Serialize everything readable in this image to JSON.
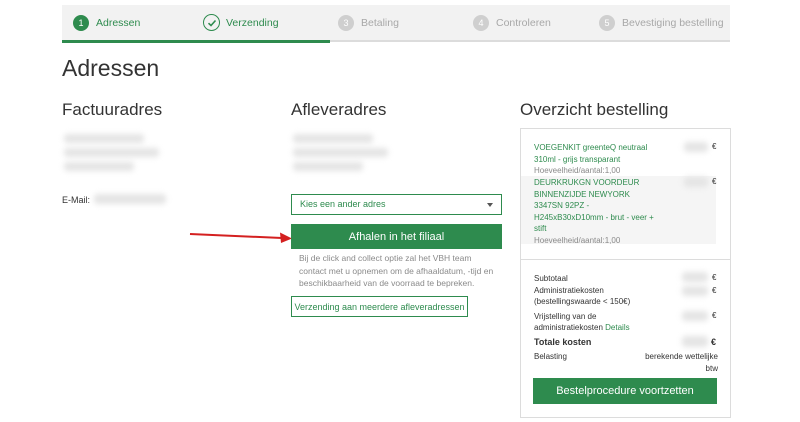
{
  "stepper": {
    "steps": [
      {
        "num": "1",
        "label": "Adressen"
      },
      {
        "label": "Verzending"
      },
      {
        "num": "3",
        "label": "Betaling"
      },
      {
        "num": "4",
        "label": "Controleren"
      },
      {
        "num": "5",
        "label": "Bevestiging bestelling"
      }
    ]
  },
  "page": {
    "title": "Adressen"
  },
  "billing": {
    "heading": "Factuuradres",
    "email_label": "E-Mail:"
  },
  "delivery": {
    "heading": "Afleveradres",
    "select_value": "Kies een ander adres",
    "pickup_button": "Afhalen in het filiaal",
    "note": "Bij de click and collect optie zal het VBH team contact met u opnemen om de afhaaldatum, -tijd en beschikbaarheid van de voorraad te bepreken.",
    "multi_button": "Verzending aan meerdere afleveradressen"
  },
  "overview": {
    "heading": "Overzicht bestelling",
    "items": [
      {
        "name": "VOEGENKIT greenteQ neutraal 310ml - grijs transparant",
        "qty": "Hoeveelheid/aantal:1,00",
        "currency": "€"
      },
      {
        "name": "DEURKRUKGN VOORDEUR BINNENZIJDE NEWYORK 3347SN 92PZ - H245xB30xD10mm - brut - veer + stift",
        "qty": "Hoeveelheid/aantal:1,00",
        "currency": "€"
      }
    ],
    "summary": {
      "subtotal_label": "Subtotaal",
      "admin_label": "Administratiekosten (bestellingswaarde < 150€)",
      "exemption_label": "Vrijstelling van de administratiekosten",
      "details_link": "Details",
      "total_label": "Totale kosten",
      "tax_label": "Belasting",
      "tax_value": "berekende wettelijke btw",
      "currency": "€",
      "continue_button": "Bestelprocedure voortzetten"
    }
  },
  "colors": {
    "accent": "#2e8b4e",
    "arrow": "#d42020"
  }
}
